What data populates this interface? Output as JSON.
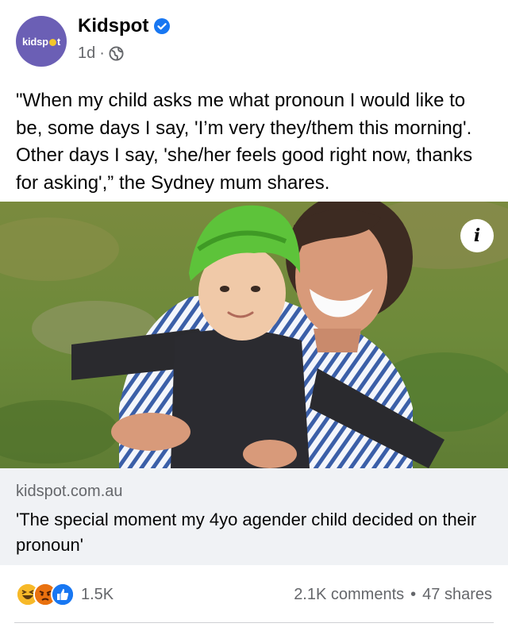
{
  "post": {
    "page_name": "Kidspot",
    "avatar_text_before": "kidsp",
    "avatar_text_after": "t",
    "time": "1d",
    "separator": "·",
    "text": "\"When my child asks me what pronoun I would like to be, some days I say, 'I’m very they/them this morning'. Other days I say, 'she/her feels good right now, thanks for asking',” the Sydney mum shares."
  },
  "photo": {
    "info_label": "i"
  },
  "link": {
    "domain": "kidspot.com.au",
    "title": "'The special moment my 4yo agender child decided on their pronoun'"
  },
  "stats": {
    "reactions": [
      "haha-icon",
      "angry-icon",
      "like-icon"
    ],
    "reaction_count": "1.5K",
    "comments": "2.1K comments",
    "dot": "•",
    "shares": "47 shares"
  },
  "colors": {
    "brand": "#6b5fb5",
    "verified": "#1877f2",
    "secondary_text": "#65676b",
    "link_bg": "#f0f2f5"
  }
}
